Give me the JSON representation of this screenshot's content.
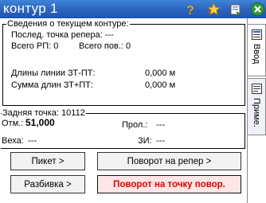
{
  "titlebar": {
    "title": "контур 1",
    "icons": [
      "help-icon",
      "star-icon",
      "settings-icon",
      "close-icon"
    ],
    "accent": "#2a63bf"
  },
  "current_contour": {
    "legend": "Сведения о текущем контуре:",
    "last_bench_label": "Послед. точка репера: ---",
    "total_rp_label": "Всего РП: 0",
    "total_turns_label": "Всего пов.: 0",
    "line_length_label": "Длины линии ЗТ-ПТ:",
    "line_length_value": "0,000 м",
    "sum_length_label": "Сумма длин ЗТ+ПТ:",
    "sum_length_value": "0,000 м"
  },
  "backsight": {
    "legend": "Задняя точка: 10112",
    "elev_label": "Отм.:",
    "elev_value": "51,000",
    "prol_label": "Прол.:",
    "prol_value": "---",
    "rod_label": "Веха:",
    "rod_value": "---",
    "vi_label": "ЗИ:",
    "vi_value": "---"
  },
  "buttons": {
    "picket": "Пикет >",
    "turn_to_bench": "Поворот на репер >",
    "stakeout": "Разбивка >",
    "turn_to_turn_point": "Поворот на точку повор."
  },
  "tabs": {
    "input": "Ввод",
    "notes": "Приме."
  },
  "colors": {
    "alert": "#e00000",
    "alert_bg": "#ffe6e6"
  }
}
